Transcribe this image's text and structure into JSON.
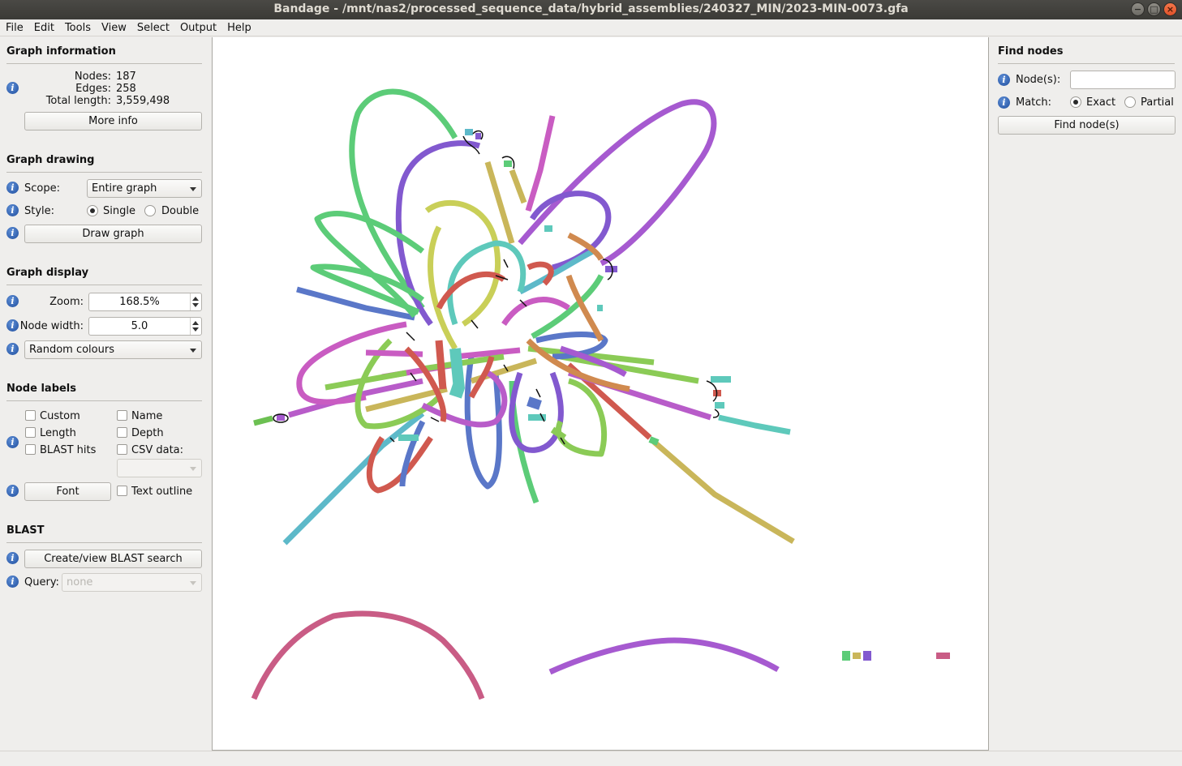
{
  "window": {
    "title": "Bandage - /mnt/nas2/processed_sequence_data/hybrid_assemblies/240327_MIN/2023-MIN-0073.gfa",
    "controls": [
      "−",
      "□",
      "×"
    ]
  },
  "menu": [
    "File",
    "Edit",
    "Tools",
    "View",
    "Select",
    "Output",
    "Help"
  ],
  "graph_information": {
    "title": "Graph information",
    "nodes_label": "Nodes:",
    "nodes_value": "187",
    "edges_label": "Edges:",
    "edges_value": "258",
    "length_label": "Total length:",
    "length_value": "3,559,498",
    "more_info_button": "More info"
  },
  "graph_drawing": {
    "title": "Graph drawing",
    "scope_label": "Scope:",
    "scope_value": "Entire graph",
    "style_label": "Style:",
    "style_single": "Single",
    "style_double": "Double",
    "draw_button": "Draw graph"
  },
  "graph_display": {
    "title": "Graph display",
    "zoom_label": "Zoom:",
    "zoom_value": "168.5%",
    "node_width_label": "Node width:",
    "node_width_value": "5.0",
    "colour_scheme": "Random colours"
  },
  "node_labels": {
    "title": "Node labels",
    "custom": "Custom",
    "name": "Name",
    "length": "Length",
    "depth": "Depth",
    "blast_hits": "BLAST hits",
    "csv_data": "CSV data:",
    "font_button": "Font",
    "text_outline": "Text outline"
  },
  "blast": {
    "title": "BLAST",
    "search_button": "Create/view BLAST search",
    "query_label": "Query:",
    "query_value": "none"
  },
  "find_nodes": {
    "title": "Find nodes",
    "nodes_label": "Node(s):",
    "match_label": "Match:",
    "match_exact": "Exact",
    "match_partial": "Partial",
    "find_button": "Find node(s)"
  }
}
